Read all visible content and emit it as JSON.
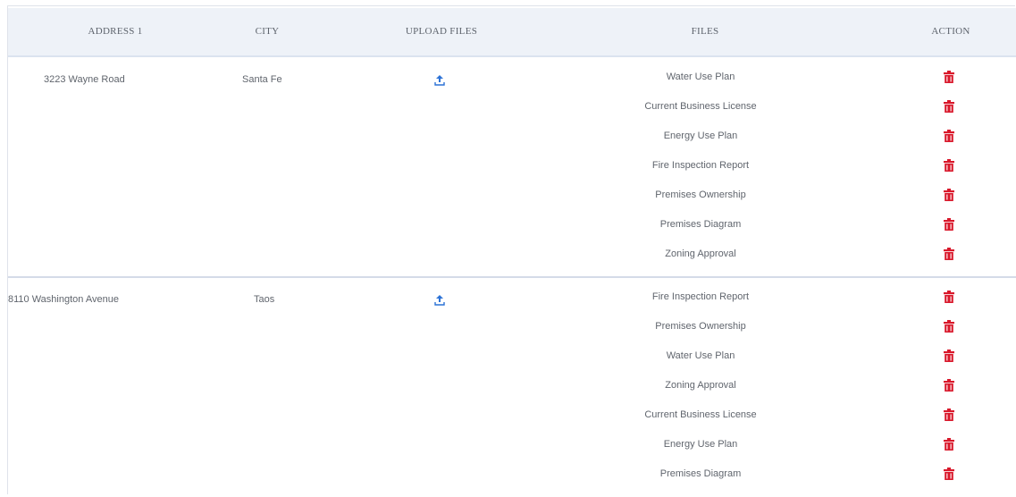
{
  "table": {
    "columns": {
      "address": "ADDRESS 1",
      "city": "CITY",
      "upload": "UPLOAD FILES",
      "files": "FILES",
      "action": "ACTION"
    },
    "rows": [
      {
        "address": "3223 Wayne Road",
        "city": "Santa Fe",
        "upload_icon": "upload-icon",
        "files": [
          "Water Use Plan",
          "Current Business License",
          "Energy Use Plan",
          "Fire Inspection Report",
          "Premises Ownership",
          "Premises Diagram",
          "Zoning Approval"
        ]
      },
      {
        "address": "8110 Washington Avenue",
        "city": "Taos",
        "upload_icon": "upload-icon",
        "files": [
          "Fire Inspection Report",
          "Premises Ownership",
          "Water Use Plan",
          "Zoning Approval",
          "Current Business License",
          "Energy Use Plan",
          "Premises Diagram"
        ]
      }
    ]
  },
  "colors": {
    "header_bg": "#eef2f8",
    "delete_red": "#d9182b",
    "upload_blue": "#2c72d6",
    "divider": "#d4dbe8"
  },
  "icons": {
    "upload": "upload-icon",
    "delete": "trash-icon"
  }
}
